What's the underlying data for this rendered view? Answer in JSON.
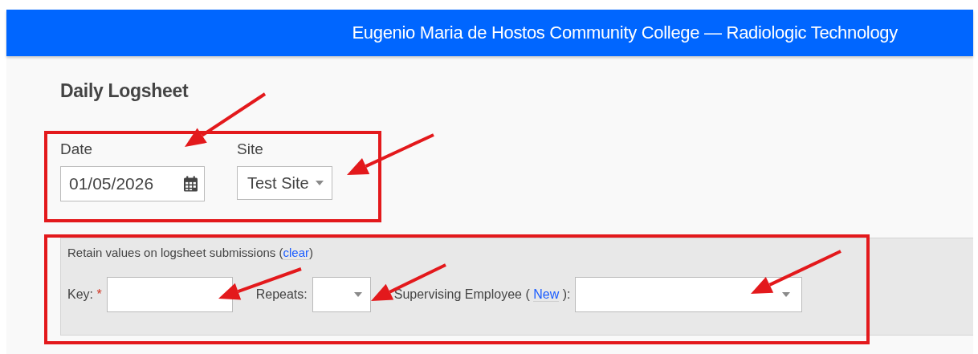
{
  "header": {
    "title": "Eugenio Maria de Hostos Community College — Radiologic Technology"
  },
  "page": {
    "title": "Daily Logsheet"
  },
  "date_field": {
    "label": "Date",
    "value": "01/05/2026"
  },
  "site_field": {
    "label": "Site",
    "value": "Test Site"
  },
  "retain_panel": {
    "text": "Retain values on logsheet submissions (",
    "link": "clear",
    "text_end": ")",
    "key_field": {
      "label": "Key:",
      "required_mark": "*"
    },
    "repeats_field": {
      "label": "Repeats:"
    },
    "supervisor_field": {
      "label_start": "Supervising Employee (",
      "link": "New",
      "label_end": "):"
    }
  }
}
